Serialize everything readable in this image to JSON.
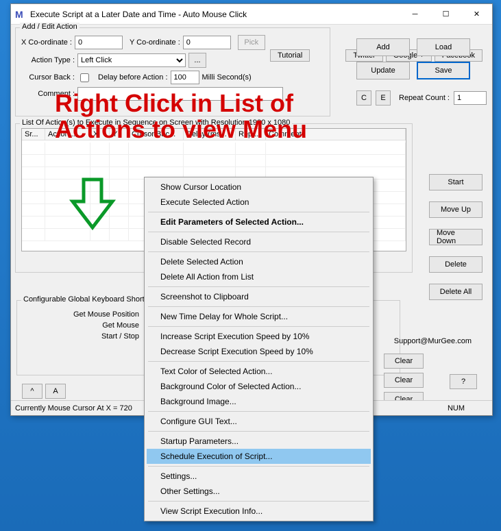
{
  "title": "Execute Script at a Later Date and Time - Auto Mouse Click",
  "links": {
    "tutorial": "Tutorial",
    "twitter": "Twitter",
    "google": "Google +",
    "facebook": "Facebook"
  },
  "addedit": {
    "legend": "Add / Edit Action",
    "x_label": "X Co-ordinate :",
    "x_val": "0",
    "y_label": "Y Co-ordinate :",
    "y_val": "0",
    "pick": "Pick",
    "action_type_label": "Action Type :",
    "action_type": "Left Click",
    "ellipsis": "...",
    "cursor_back_label": "Cursor Back :",
    "delay_label": "Delay before Action :",
    "delay_val": "100",
    "delay_unit": "Milli Second(s)",
    "comment_label": "Comment :",
    "c_btn": "C",
    "e_btn": "E",
    "repeat_label": "Repeat Count :",
    "repeat_val": "1",
    "add": "Add",
    "load": "Load",
    "update": "Update",
    "save": "Save"
  },
  "list": {
    "legend": "List Of Action(s) to Execute in Sequence on Screen with Resolution 1920 x 1080",
    "headers": [
      "Sr...",
      "Action...",
      "X",
      "Y",
      "Cursor Bac...",
      "Delay (ms...",
      "Rep...",
      "Comment"
    ]
  },
  "side": {
    "start": "Start",
    "moveup": "Move Up",
    "movedown": "Move Down",
    "delete": "Delete",
    "deleteall": "Delete All"
  },
  "cfg": {
    "header": "Configurable Global Keyboard Shortcuts",
    "r1": "Get Mouse Position",
    "r2": "Get Mouse",
    "r3": "Start / Stop",
    "clear": "Clear",
    "q": "?",
    "caret": "^",
    "a": "A"
  },
  "support": "Support@MurGee.com",
  "overlay": {
    "l1": "Right Click in List of",
    "l2": "Actions to view Menu"
  },
  "menu": {
    "items": [
      {
        "t": "Show Cursor Location"
      },
      {
        "t": "Execute Selected Action"
      },
      {
        "sep": true
      },
      {
        "t": "Edit Parameters of Selected Action...",
        "bold": true
      },
      {
        "sep": true
      },
      {
        "t": "Disable Selected Record"
      },
      {
        "sep": true
      },
      {
        "t": "Delete Selected Action"
      },
      {
        "t": "Delete All Action from List"
      },
      {
        "sep": true
      },
      {
        "t": "Screenshot to Clipboard"
      },
      {
        "sep": true
      },
      {
        "t": "New Time Delay for Whole Script..."
      },
      {
        "sep": true
      },
      {
        "t": "Increase Script Execution Speed by 10%"
      },
      {
        "t": "Decrease Script Execution Speed by 10%"
      },
      {
        "sep": true
      },
      {
        "t": "Text Color of Selected Action..."
      },
      {
        "t": "Background Color of Selected Action..."
      },
      {
        "t": "Background Image..."
      },
      {
        "sep": true
      },
      {
        "t": "Configure GUI Text..."
      },
      {
        "sep": true
      },
      {
        "t": "Startup Parameters..."
      },
      {
        "t": "Schedule Execution of Script...",
        "hl": true
      },
      {
        "sep": true
      },
      {
        "t": "Settings..."
      },
      {
        "t": "Other Settings..."
      },
      {
        "sep": true
      },
      {
        "t": "View Script Execution Info..."
      }
    ]
  },
  "status": {
    "left": "Currently Mouse Cursor At X = 720",
    "num": "NUM"
  }
}
